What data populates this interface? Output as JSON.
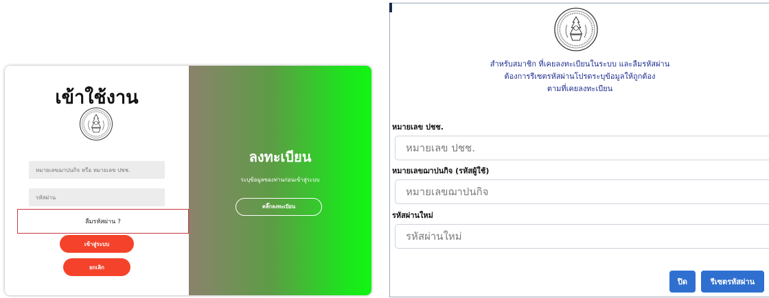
{
  "login": {
    "title": "เข้าใช้งาน",
    "username_placeholder": "หมายเลขฌาปนกิจ หรือ หมายเลข ปชช.",
    "password_placeholder": "รหัสผ่าน",
    "forgot_label": "ลืมรหัสผ่าน ?",
    "login_button": "เข้าสู่ระบบ",
    "cancel_button": "ยกเลิก",
    "button_color": "#f4432a"
  },
  "register": {
    "title": "ลงทะเบียน",
    "subtitle": "ระบุข้อมูลของท่านก่อนเข้าสู่ระบบ",
    "button": "คลิ๊กลงทะเบียน",
    "gradient_end_color": "#12f512"
  },
  "reset": {
    "intro_lines": [
      "สำหรับสมาชิก ที่เคยลงทะเบียนในระบบ และลืมรหัสผ่าน",
      "ต้องการรีเซตรหัสผ่านโปรดระบุข้อมูลให้ถูกต้อง",
      "ตามที่เคยลงทะเบียน"
    ],
    "fields": [
      {
        "label": "หมายเลข ปชช.",
        "placeholder": "หมายเลข ปชช."
      },
      {
        "label": "หมายเลขฌาปนกิจ (รหัสผู้ใช้)",
        "placeholder": "หมายเลขฌาปนกิจ"
      },
      {
        "label": "รหัสผ่านใหม่",
        "placeholder": "รหัสผ่านใหม่"
      }
    ],
    "close_button": "ปิด",
    "reset_button": "รีเซตรหัสผ่าน",
    "button_color": "#2f6fd0"
  },
  "icons": {
    "seal": "emblem-seal-icon"
  }
}
